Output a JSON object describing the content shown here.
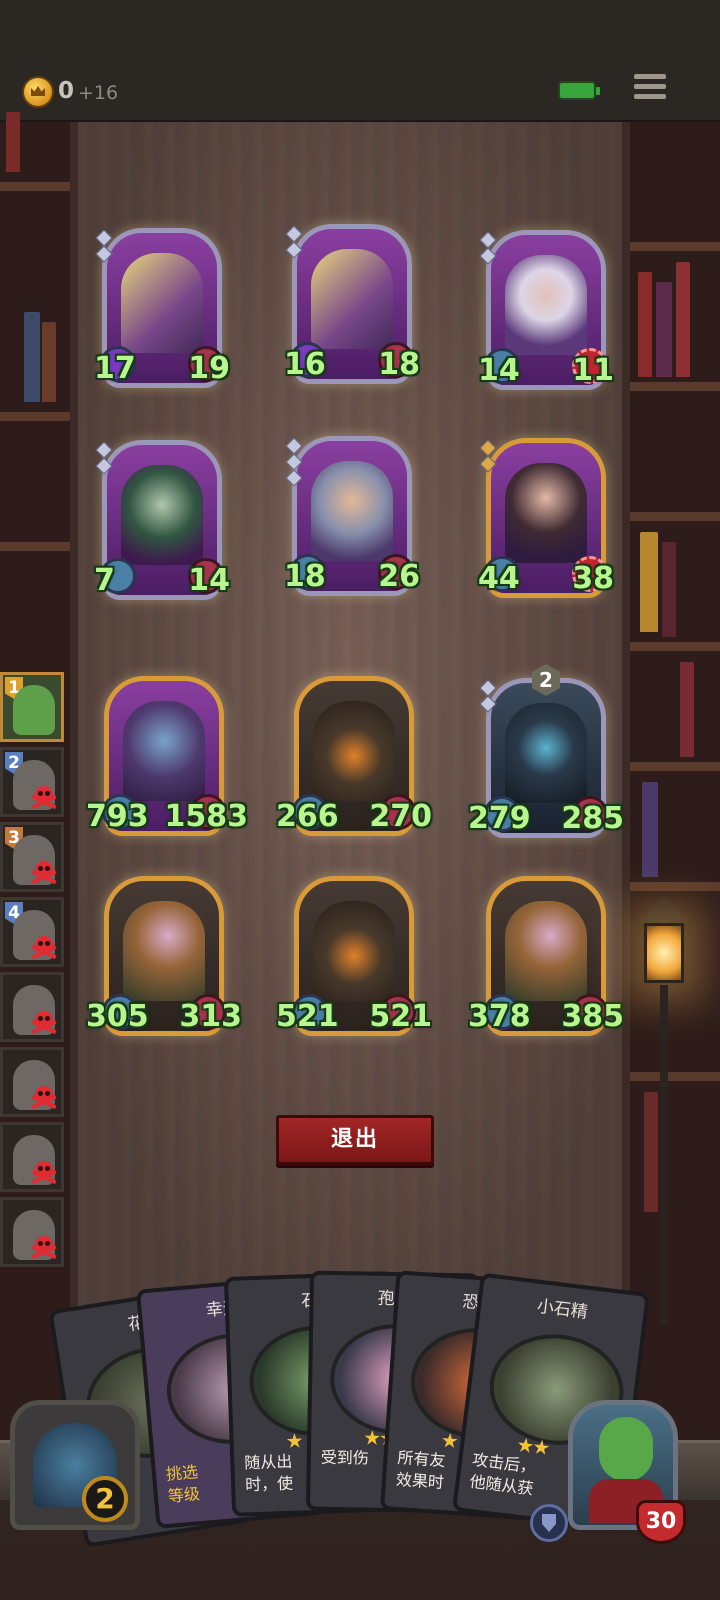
{
  "topbar": {
    "gold": "0",
    "gold_income": "+16"
  },
  "colors": {
    "stat_text": "#b8f58e",
    "exit_button": "#a22626",
    "frame_silver": "#9c97b8",
    "frame_gold": "#d99a3a",
    "hero_health": "#c42b2e"
  },
  "board": {
    "units": [
      {
        "atk": "17",
        "hp": "19",
        "frame": "silver",
        "atk_style": "violet",
        "hp_style": "normal",
        "icon": "cross-shield-bandit-portrait"
      },
      {
        "atk": "16",
        "hp": "18",
        "frame": "silver",
        "atk_style": "violet",
        "hp_style": "normal",
        "icon": "cross-shield-bandit-portrait"
      },
      {
        "atk": "14",
        "hp": "11",
        "frame": "silver",
        "atk_style": "normal",
        "hp_style": "target",
        "icon": "old-dwarf-portrait"
      },
      {
        "atk": "7",
        "hp": "14",
        "frame": "silver",
        "atk_style": "normal",
        "hp_style": "normal",
        "icon": "horned-elf-portrait"
      },
      {
        "atk": "18",
        "hp": "26",
        "frame": "silver",
        "atk_style": "normal",
        "hp_style": "normal",
        "icon": "knight-portrait"
      },
      {
        "atk": "44",
        "hp": "38",
        "frame": "gold",
        "atk_style": "normal",
        "hp_style": "target",
        "icon": "mustache-gentleman-portrait"
      }
    ],
    "enemies": [
      {
        "atk": "793",
        "hp": "1583",
        "frame": "gold",
        "icon": "mushroom-spider-portrait"
      },
      {
        "atk": "266",
        "hp": "270",
        "frame": "gold",
        "icon": "evil-tree-portrait"
      },
      {
        "atk": "279",
        "hp": "285",
        "frame": "silver",
        "badge": "2",
        "icon": "spore-creature-portrait"
      },
      {
        "atk": "305",
        "hp": "313",
        "frame": "gold",
        "icon": "flower-witch-portrait"
      },
      {
        "atk": "521",
        "hp": "521",
        "frame": "gold",
        "icon": "evil-tree-portrait"
      },
      {
        "atk": "378",
        "hp": "385",
        "frame": "gold",
        "icon": "flower-witch-portrait"
      }
    ]
  },
  "opponents": [
    {
      "rank": "1",
      "active": true,
      "color": "#e0a12a"
    },
    {
      "rank": "2",
      "active": false,
      "color": "#5a7fc0"
    },
    {
      "rank": "3",
      "active": false,
      "color": "#c27a3a"
    },
    {
      "rank": "4",
      "active": false,
      "color": "#5a7fc0"
    },
    {
      "rank": "",
      "active": false,
      "color": ""
    },
    {
      "rank": "",
      "active": false,
      "color": ""
    },
    {
      "rank": "",
      "active": false,
      "color": ""
    },
    {
      "rank": "",
      "active": false,
      "color": ""
    }
  ],
  "exit_button": "退出",
  "hand": [
    {
      "title": "花",
      "text": "",
      "stars": ""
    },
    {
      "title": "幸运",
      "text": "挑选\n等级",
      "stars": ""
    },
    {
      "title": "石",
      "text": "随从出\n时，使",
      "stars": "★"
    },
    {
      "title": "孢子",
      "text": "受到伤",
      "stars": "★★"
    },
    {
      "title": "恐怖",
      "text": "所有友\n效果时",
      "stars": "★"
    },
    {
      "title": "小石精",
      "text": "攻击后，\n他随从获",
      "stars": "★★"
    }
  ],
  "player": {
    "tier": "2",
    "health": "30"
  }
}
